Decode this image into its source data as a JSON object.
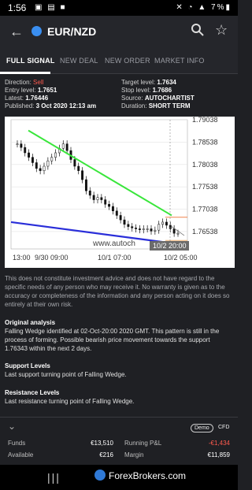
{
  "status_bar": {
    "time": "1:56",
    "battery": "7%"
  },
  "header": {
    "symbol": "EUR/NZD"
  },
  "tabs": [
    "FULL SIGNAL",
    "NEW DEAL",
    "NEW ORDER",
    "MARKET INFO"
  ],
  "signal": {
    "direction_label": "Direction:",
    "direction_value": "Sell",
    "entry_label": "Entry level:",
    "entry_value": "1.7651",
    "latest_label": "Latest:",
    "latest_value": "1.76446",
    "published_label": "Published:",
    "published_value": "3 Oct 2020 12:13 am",
    "target_label": "Target level:",
    "target_value": "1.7634",
    "stop_label": "Stop level:",
    "stop_value": "1.7686",
    "source_label": "Source:",
    "source_value": "AUTOCHARTIST",
    "duration_label": "Duration:",
    "duration_value": "SHORT TERM"
  },
  "chart_data": {
    "type": "line",
    "x_ticks": [
      "13:00",
      "9/30 09:00",
      "10/1 07:00",
      "10/2 05:00"
    ],
    "y_ticks": [
      "1.79038",
      "1.78538",
      "1.78038",
      "1.77538",
      "1.77038",
      "1.76538"
    ],
    "watermark": "www.autoch",
    "time_label": "10/2 20:00",
    "y_range": [
      1.7615,
      1.7904
    ],
    "candles": [
      1.785,
      1.7842,
      1.783,
      1.782,
      1.7808,
      1.7795,
      1.779,
      1.78,
      1.7812,
      1.782,
      1.783,
      1.784,
      1.785,
      1.7835,
      1.7815,
      1.78,
      1.779,
      1.777,
      1.7745,
      1.7735,
      1.7725,
      1.773,
      1.7725,
      1.7715,
      1.771,
      1.77,
      1.769,
      1.768,
      1.767,
      1.7665,
      1.7662,
      1.766,
      1.7658,
      1.766,
      1.766,
      1.7655,
      1.7657,
      1.767,
      1.7675,
      1.7668,
      1.766,
      1.765,
      1.765
    ],
    "upper_line": [
      1.788,
      1.769
    ],
    "lower_line": [
      1.7675,
      1.7628
    ],
    "target": 1.7634,
    "stop": 1.7686,
    "colors": {
      "upper": "#39e63b",
      "lower": "#2a2ed9",
      "stop": "#f0824a",
      "target": "#f0b070"
    }
  },
  "disclaimer": "This does not constitute investment advice and does not have regard to the specific needs of any person who may receive it. No warranty is given as to the accuracy or completeness of the information and any person acting on it does so entirely at their own risk.",
  "analysis": {
    "heading": "Original analysis",
    "text": "Falling Wedge identified at 02-Oct-20:00 2020 GMT. This pattern is still in the process of forming. Possible bearish price movement towards the support 1.76343 within the next 2 days."
  },
  "support": {
    "heading": "Support Levels",
    "text": "Last support turning point of Falling Wedge."
  },
  "resistance": {
    "heading": "Resistance Levels",
    "text": "Last resistance turning point of Falling Wedge."
  },
  "account": {
    "demo": "Demo",
    "cfd": "CFD",
    "funds_label": "Funds",
    "funds_value": "€13,510",
    "available_label": "Available",
    "available_value": "€216",
    "pnl_label": "Running P&L",
    "pnl_value": "-€1,434",
    "margin_label": "Margin",
    "margin_value": "€11,859"
  },
  "footer": {
    "logo": "ForexBrokers.com"
  }
}
